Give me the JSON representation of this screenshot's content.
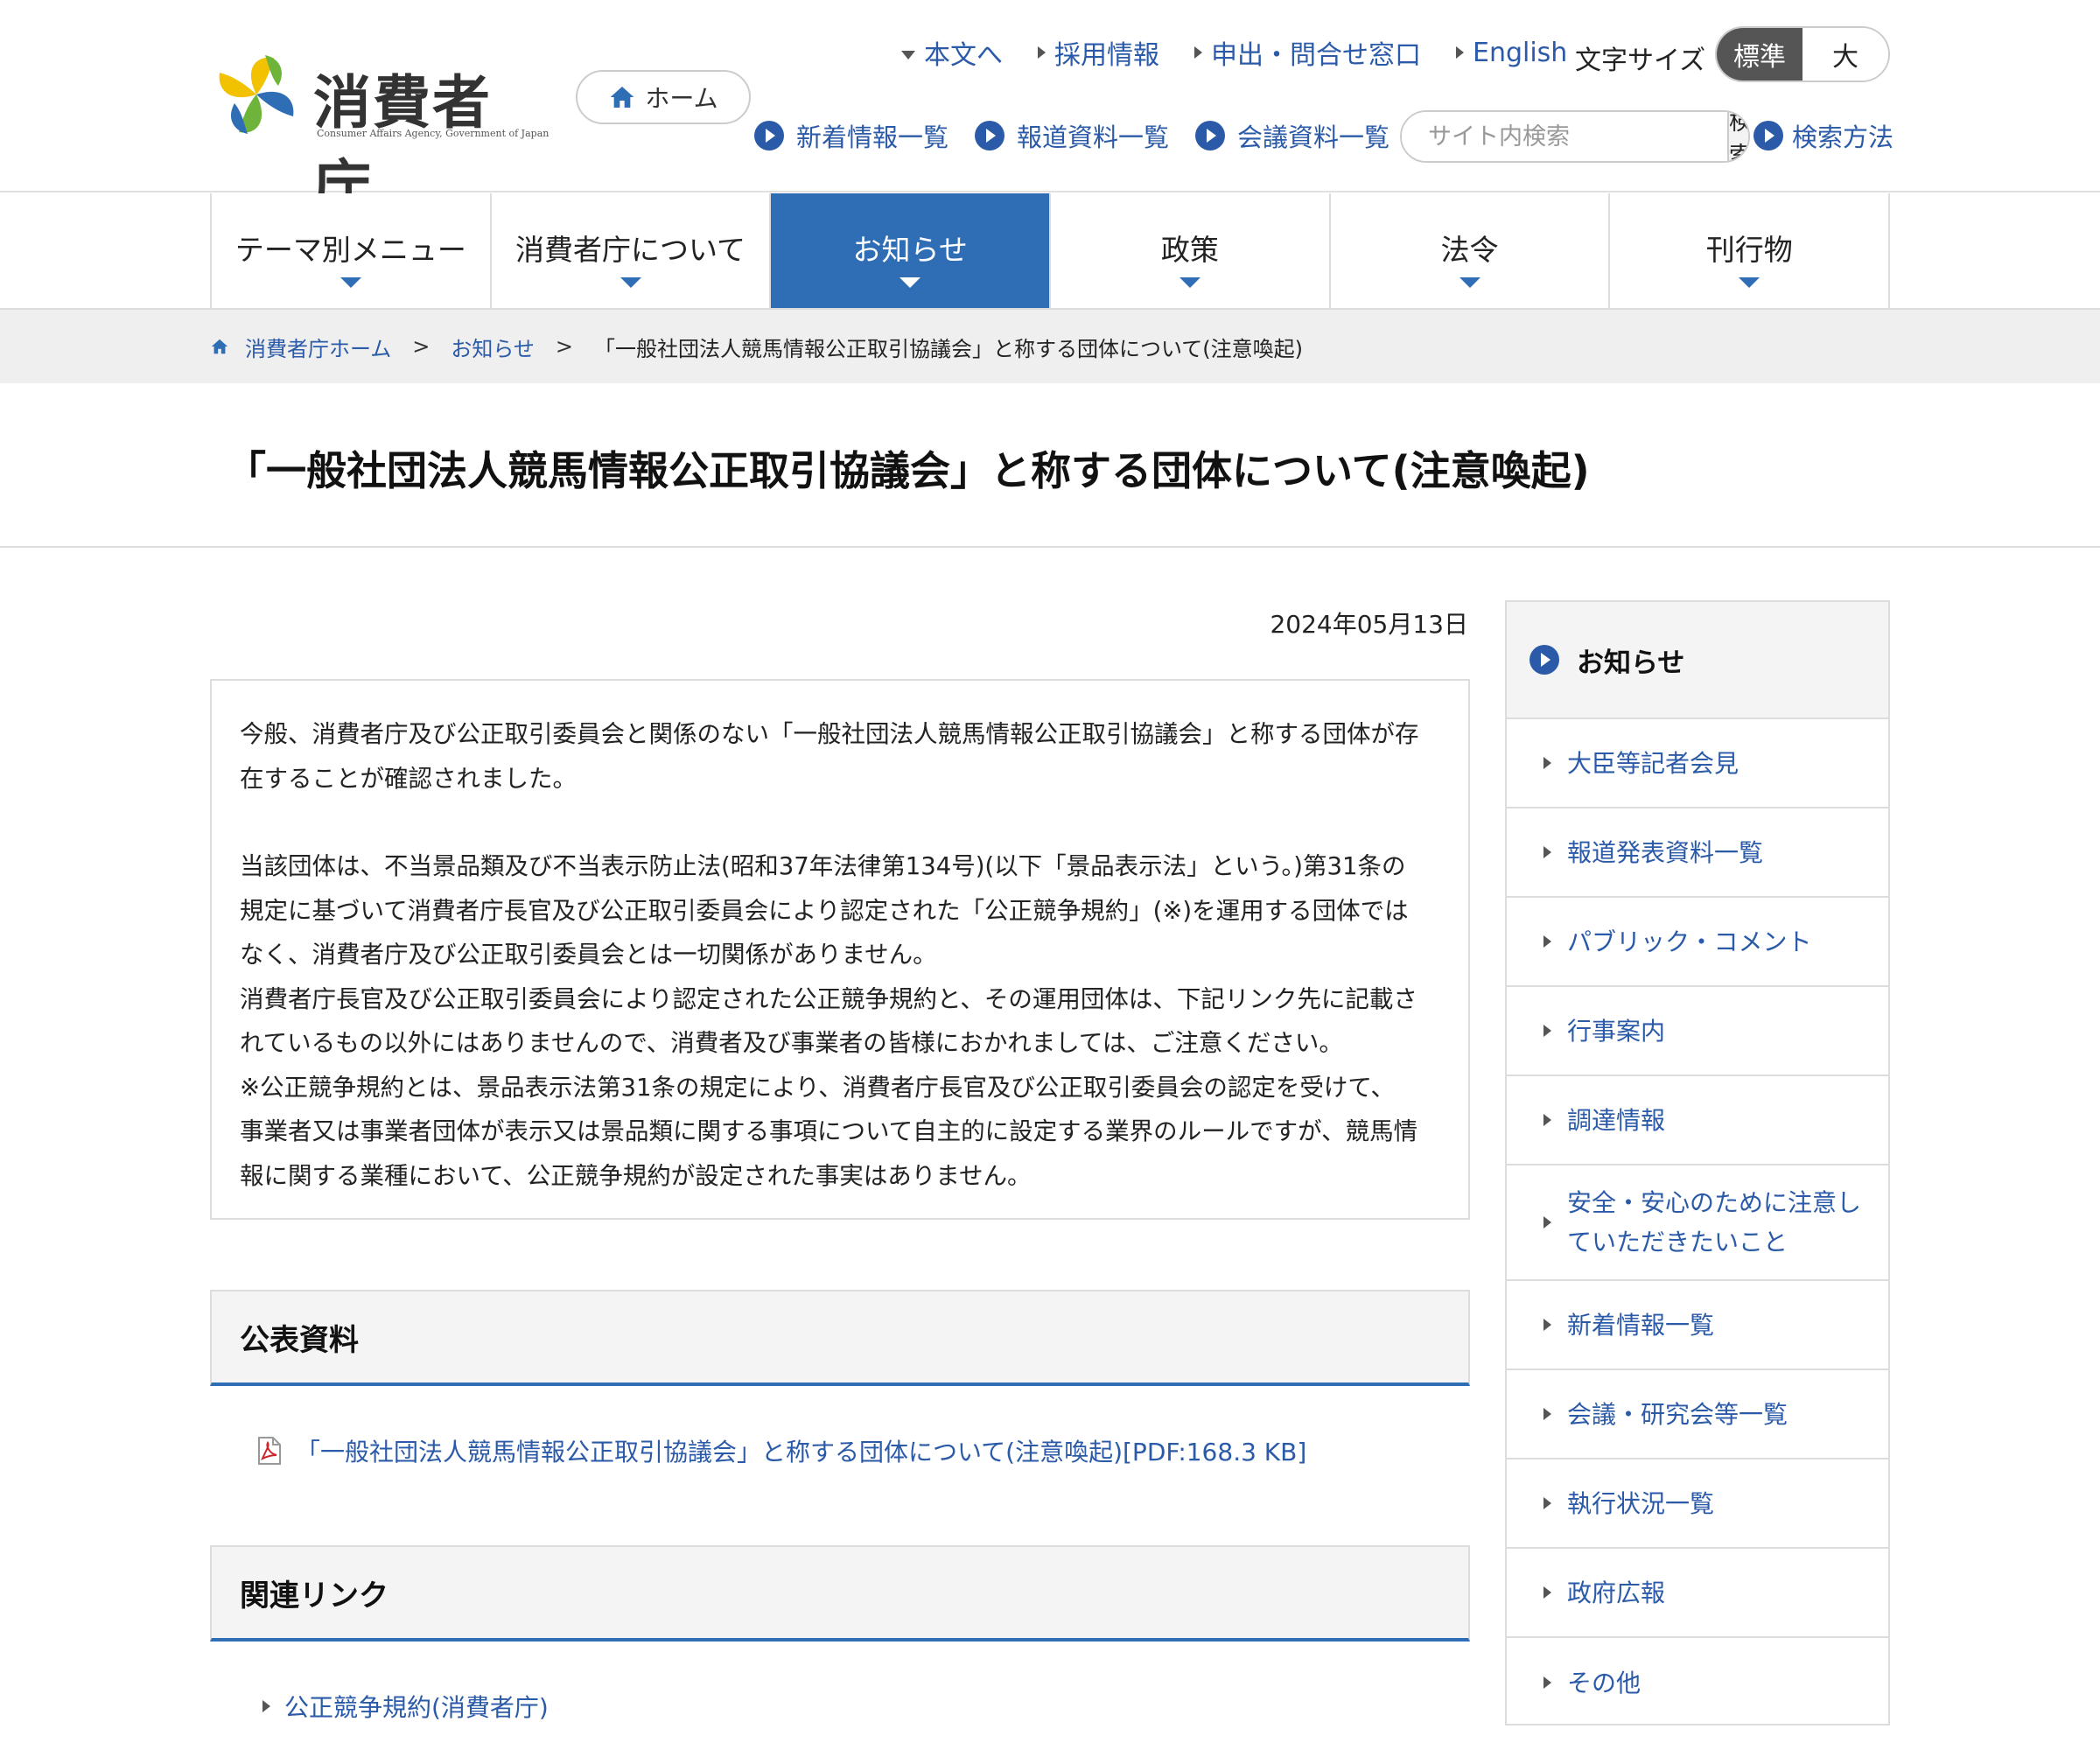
{
  "header": {
    "logo_text": "消費者庁",
    "logo_sub": "Consumer Affairs Agency, Government of Japan",
    "home_label": "ホーム",
    "top_links": [
      "本文へ",
      "採用情報",
      "申出・問合せ窓口",
      "English"
    ],
    "font_size_label": "文字サイズ",
    "font_size_standard": "標準",
    "font_size_large": "大",
    "sub_links": [
      "新着情報一覧",
      "報道資料一覧",
      "会議資料一覧"
    ],
    "search_placeholder": "サイト内検索",
    "search_button": "検索",
    "search_help": "検索方法"
  },
  "global_nav": [
    "テーマ別メニュー",
    "消費者庁について",
    "お知らせ",
    "政策",
    "法令",
    "刊行物"
  ],
  "breadcrumb": {
    "home": "消費者庁ホーム",
    "parent": "お知らせ",
    "current": "「一般社団法人競馬情報公正取引協議会」と称する団体について(注意喚起)"
  },
  "page": {
    "title": "「一般社団法人競馬情報公正取引協議会」と称する団体について(注意喚起)",
    "date": "2024年05月13日",
    "notice_lines_1": [
      "今般、消費者庁及び公正取引委員会と関係のない「一般社団法人競馬情報公正取引協議会」と称する団体が存",
      "在することが確認されました。"
    ],
    "notice_lines_2": [
      "当該団体は、不当景品類及び不当表示防止法(昭和37年法律第134号)(以下「景品表示法」という。)第31条の",
      "規定に基づいて消費者庁長官及び公正取引委員会により認定された「公正競争規約」(※)を運用する団体では",
      "なく、消費者庁及び公正取引委員会とは一切関係がありません。",
      "消費者庁長官及び公正取引委員会により認定された公正競争規約と、その運用団体は、下記リンク先に記載さ",
      "れているもの以外にはありませんので、消費者及び事業者の皆様におかれましては、ご注意ください。",
      "※公正競争規約とは、景品表示法第31条の規定により、消費者庁長官及び公正取引委員会の認定を受けて、",
      "事業者又は事業者団体が表示又は景品類に関する事項について自主的に設定する業界のルールですが、競馬情",
      "報に関する業種において、公正競争規約が設定された事実はありません。"
    ],
    "public_docs_heading": "公表資料",
    "pdf_link": "「一般社団法人競馬情報公正取引協議会」と称する団体について(注意喚起)[PDF:168.3 KB]",
    "related_heading": "関連リンク",
    "related_links": [
      "公正競争規約(消費者庁)"
    ]
  },
  "sidebar": {
    "heading": "お知らせ",
    "items": [
      "大臣等記者会見",
      "報道発表資料一覧",
      "パブリック・コメント",
      "行事案内",
      "調達情報",
      "安全・安心のために注意し",
      "ていただきたいこと",
      "新着情報一覧",
      "会議・研究会等一覧",
      "執行状況一覧",
      "政府広報",
      "その他"
    ]
  },
  "colors": {
    "accent": "#2f6db5",
    "link": "#2a5aa8"
  }
}
